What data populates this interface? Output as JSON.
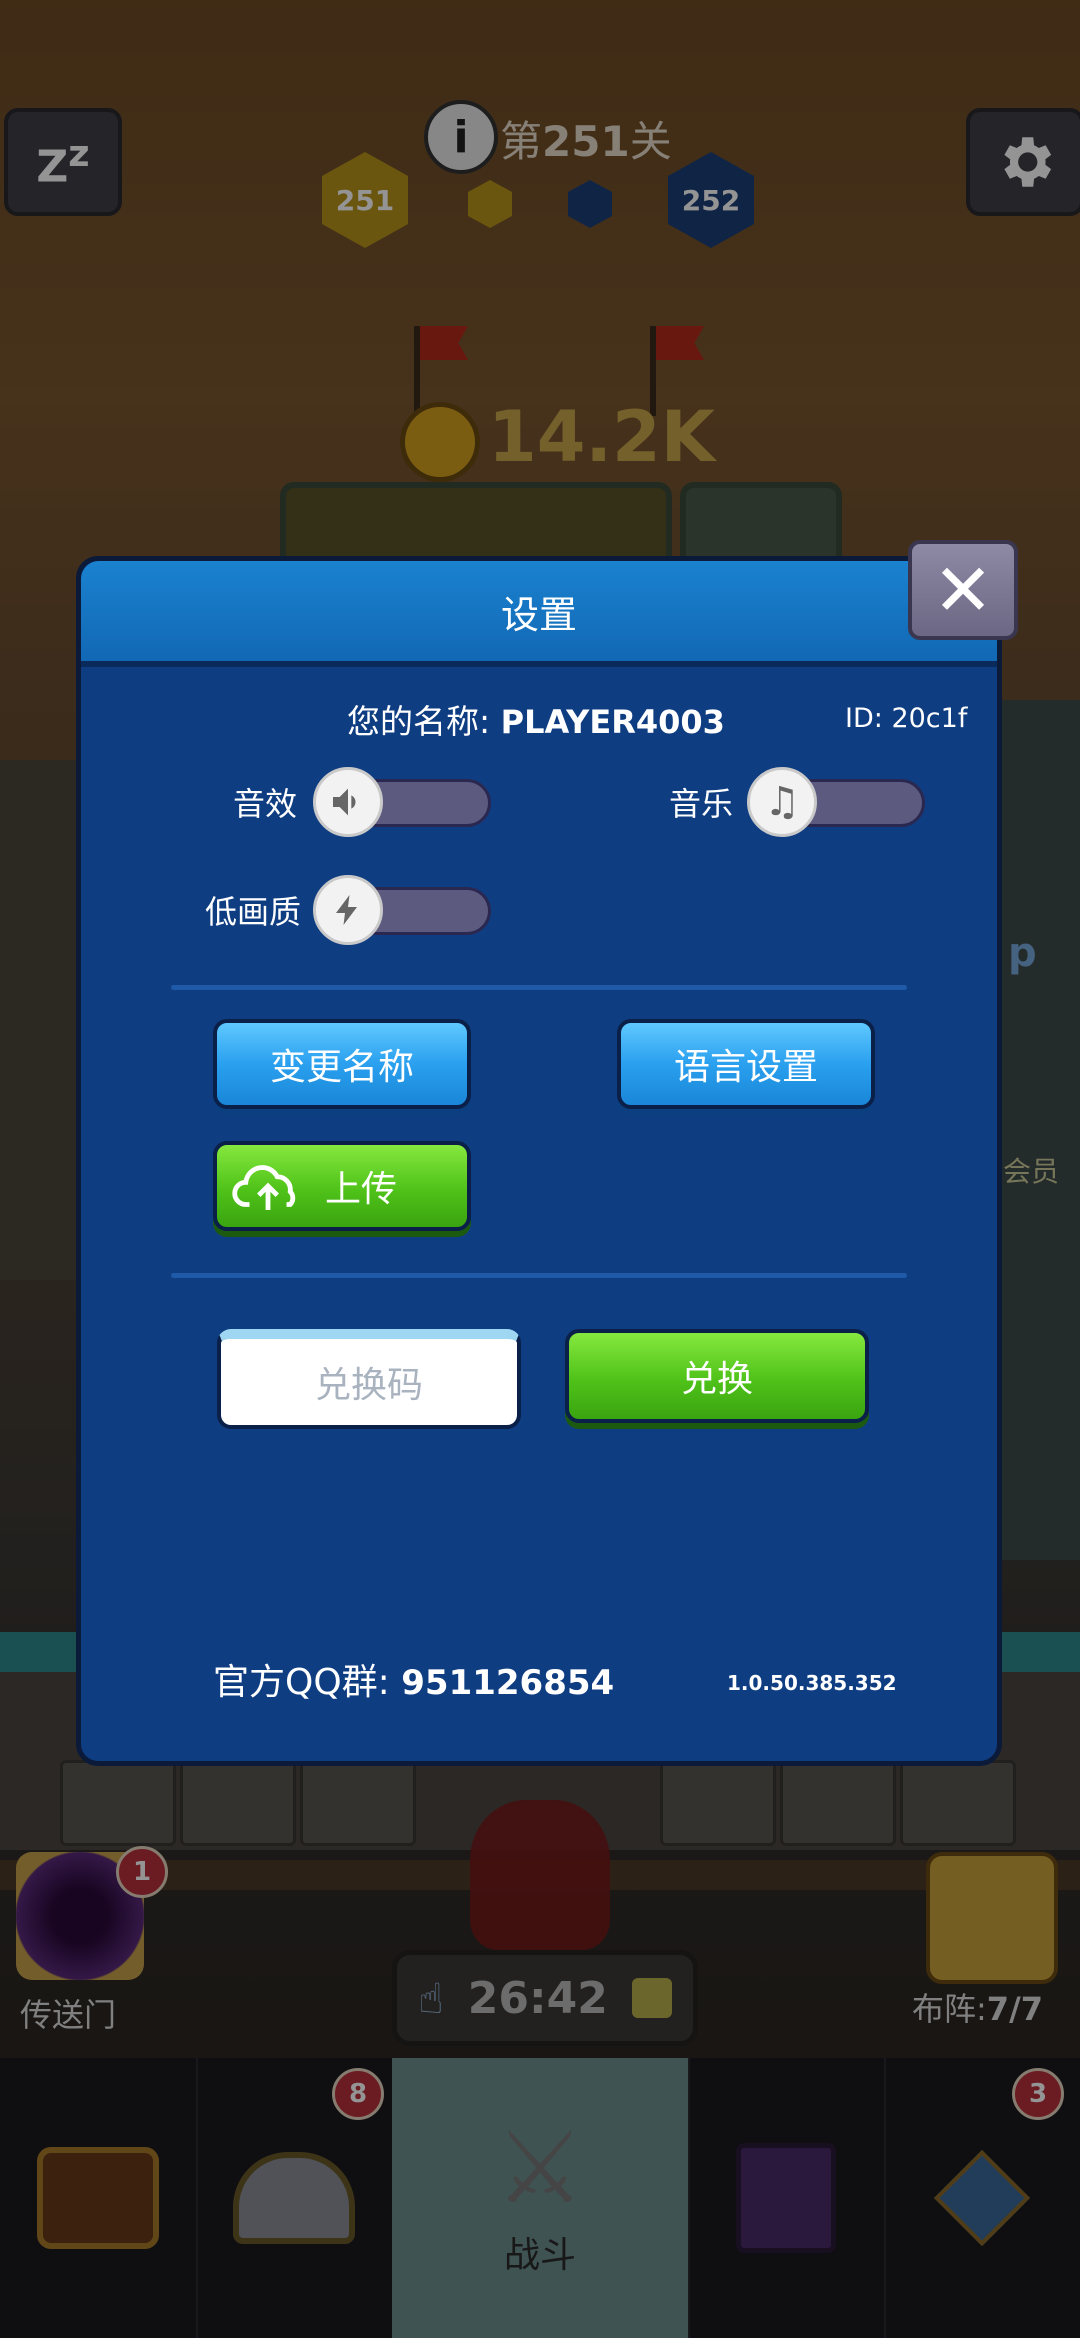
{
  "hud": {
    "level_prefix": "第",
    "level_number": "251",
    "level_suffix": "关",
    "current_level": "251",
    "next_level": "252",
    "coins": "14.2K",
    "portal_label": "传送门",
    "portal_badge": "1",
    "lineup_label": "布阵:",
    "lineup_count": "7/7",
    "timer": "26:42",
    "partial_label_member": "会员",
    "partial_label_app": "p"
  },
  "bottom_nav": {
    "tabs": [
      {
        "id": "chest",
        "icon": "treasure-chest-icon",
        "badge": ""
      },
      {
        "id": "heroes",
        "icon": "viking-helmet-icon",
        "badge": "8"
      },
      {
        "id": "battle",
        "icon": "crossed-swords-icon",
        "label": "战斗"
      },
      {
        "id": "book",
        "icon": "spell-book-icon",
        "badge": ""
      },
      {
        "id": "amulet",
        "icon": "amulet-icon",
        "badge": "3"
      }
    ]
  },
  "settings": {
    "title": "设置",
    "name_label": "您的名称:",
    "player_name": "PLAYER4003",
    "id_label": "ID:",
    "id_value": "20c1f",
    "sfx_label": "音效",
    "music_label": "音乐",
    "low_quality_label": "低画质",
    "toggles": {
      "sfx": false,
      "music": false,
      "low_quality": false
    },
    "rename_button": "变更名称",
    "language_button": "语言设置",
    "upload_button": "上传",
    "redeem_placeholder": "兑换码",
    "redeem_button": "兑换",
    "qq_group_label": "官方QQ群:",
    "qq_group_number": "951126854",
    "version": "1.0.50.385.352"
  }
}
